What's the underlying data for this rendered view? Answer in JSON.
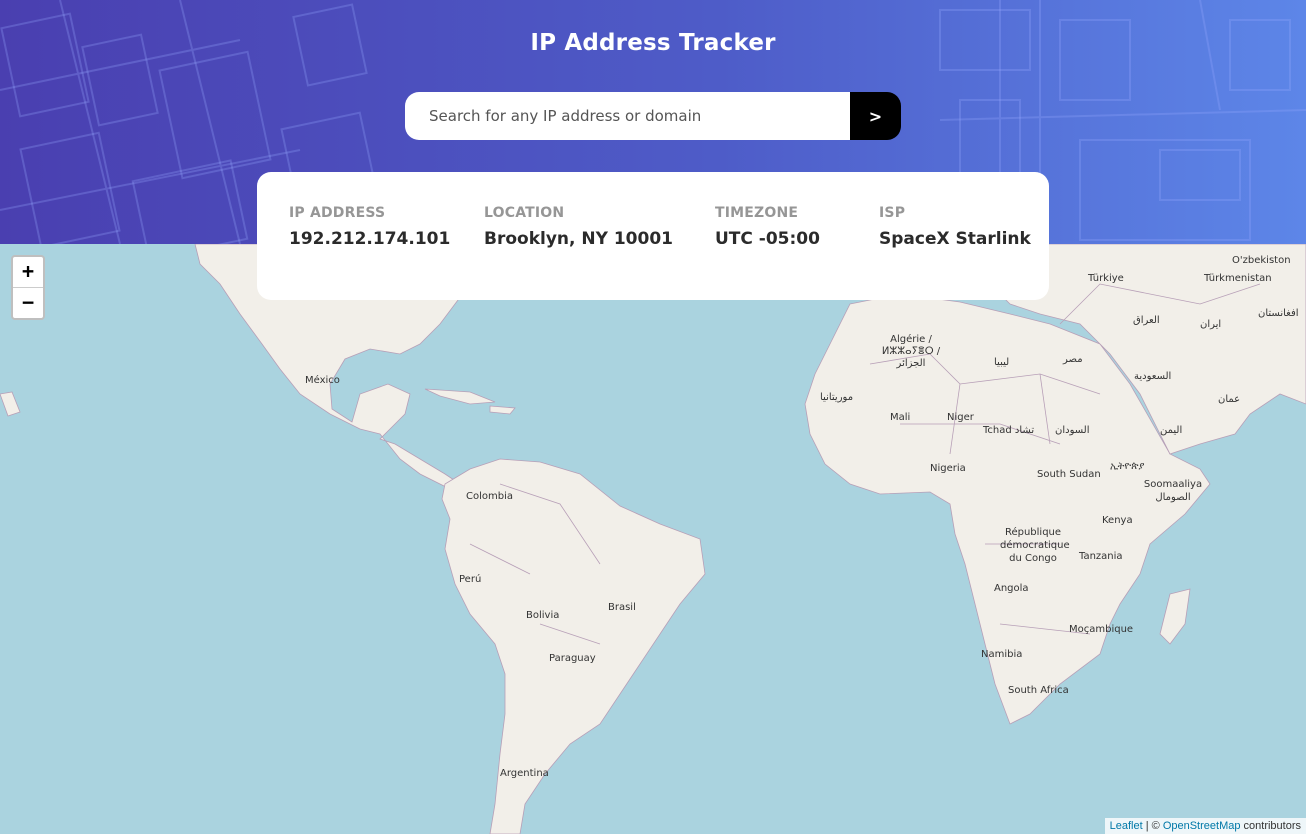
{
  "app": {
    "title": "IP Address Tracker"
  },
  "search": {
    "placeholder": "Search for any IP address or domain",
    "value": "",
    "button_glyph": ">"
  },
  "stats": {
    "ip": {
      "label": "IP ADDRESS",
      "value": "192.212.174.101"
    },
    "location": {
      "label": "LOCATION",
      "value": "Brooklyn, NY 10001"
    },
    "timezone": {
      "label": "TIMEZONE",
      "value": "UTC -05:00"
    },
    "isp": {
      "label": "ISP",
      "value": "SpaceX Starlink"
    }
  },
  "map": {
    "zoom_in": "+",
    "zoom_out": "−",
    "labels": [
      "México",
      "Colombia",
      "Perú",
      "Brasil",
      "Bolivia",
      "Paraguay",
      "Argentina",
      "Türkiye",
      "O'zbekiston",
      "Türkmenistan",
      "العراق",
      "افغانستان",
      "ایران",
      "Algérie / ⵍⵣⵣⴰⵢⴻⵔ / الجزائر",
      "ليبيا",
      "مصر",
      "موريتانيا",
      "Mali",
      "Niger",
      "Tchad تشاد",
      "السودان",
      "السعودية",
      "عمان",
      "اليمن",
      "ኢትዮጵያ",
      "Nigeria",
      "South Sudan",
      "Soomaaliya الصومال",
      "République démocratique du Congo",
      "Kenya",
      "Tanzania",
      "Angola",
      "Moçambique",
      "Namibia",
      "South Africa"
    ],
    "attribution": {
      "leaflet": "Leaflet",
      "separator": " | © ",
      "osm": "OpenStreetMap",
      "suffix": " contributors"
    }
  },
  "colors": {
    "header_start": "#4a3fb0",
    "header_end": "#5d86e8",
    "water": "#aad3df",
    "land": "#f2efe9",
    "border": "#b79fb7"
  }
}
